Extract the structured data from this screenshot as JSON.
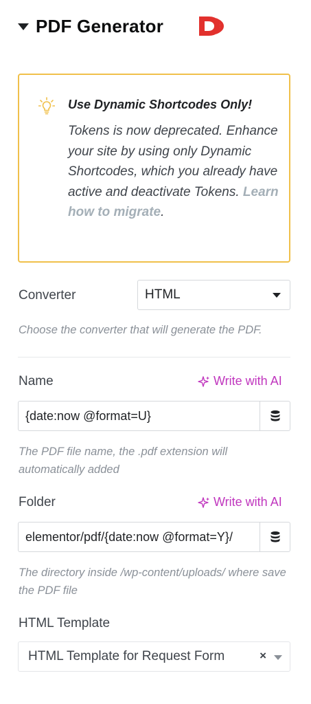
{
  "section": {
    "title": "PDF Generator",
    "brand_logo": "dynamic-ooo-logo",
    "brand_color": "#e2312d"
  },
  "notice": {
    "icon": "lightbulb-icon",
    "title": "Use Dynamic Shortcodes Only!",
    "body": "Tokens is now deprecated. Enhance your site by using only Dynamic Shortcodes, which you already have active and deactivate Tokens.",
    "link_text": "Learn how to migrate",
    "trailing": ".",
    "border_color": "#f0c04a"
  },
  "converter": {
    "label": "Converter",
    "value": "HTML",
    "help": "Choose the converter that will generate the PDF."
  },
  "name": {
    "label": "Name",
    "ai_label": "Write with AI",
    "value": "{date:now @format=U}",
    "help": "The PDF file name, the .pdf extension will automatically added"
  },
  "folder": {
    "label": "Folder",
    "ai_label": "Write with AI",
    "value": "elementor/pdf/{date:now @format=Y}/",
    "help": "The directory inside /wp-content/uploads/ where save the PDF file"
  },
  "html_template": {
    "label": "HTML Template",
    "value": "HTML Template for Request Form",
    "clear": "×"
  },
  "colors": {
    "ai_accent": "#c036be",
    "help_text": "#8a9098"
  }
}
